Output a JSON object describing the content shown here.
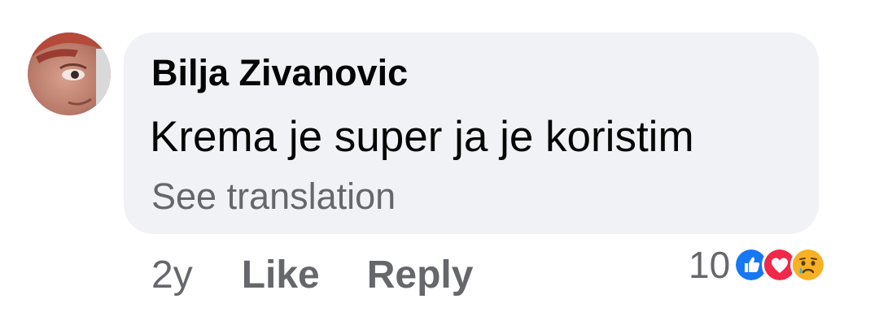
{
  "comment": {
    "author": "Bilja Zivanovic",
    "text": "Krema je super ja je koristim",
    "see_translation": "See translation",
    "time": "2y",
    "like_label": "Like",
    "reply_label": "Reply",
    "reactions": {
      "count": "10",
      "icons": [
        "like-reaction-icon",
        "love-reaction-icon",
        "sad-reaction-icon"
      ]
    }
  },
  "colors": {
    "bubble": "#f0f2f5",
    "text_primary": "#050505",
    "text_secondary": "#65676b",
    "like_blue": "#1877f2",
    "love_red": "#f02849",
    "sad_yellow": "#f7b125"
  }
}
